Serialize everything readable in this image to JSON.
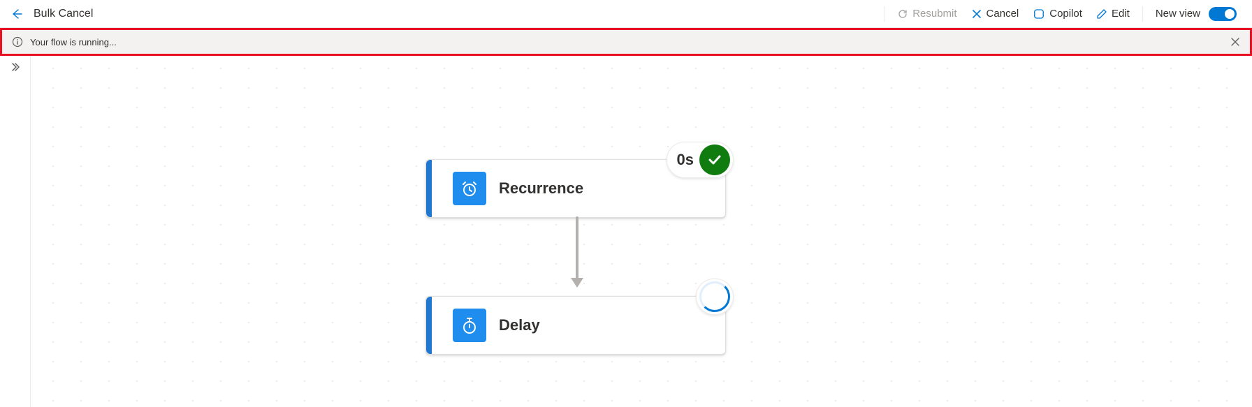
{
  "header": {
    "title": "Bulk Cancel",
    "actions": {
      "resubmit": "Resubmit",
      "cancel": "Cancel",
      "copilot": "Copilot",
      "edit": "Edit",
      "newview": "New view"
    }
  },
  "infobar": {
    "message": "Your flow is running..."
  },
  "nodes": {
    "recurrence": {
      "label": "Recurrence",
      "status_time": "0s"
    },
    "delay": {
      "label": "Delay"
    }
  }
}
